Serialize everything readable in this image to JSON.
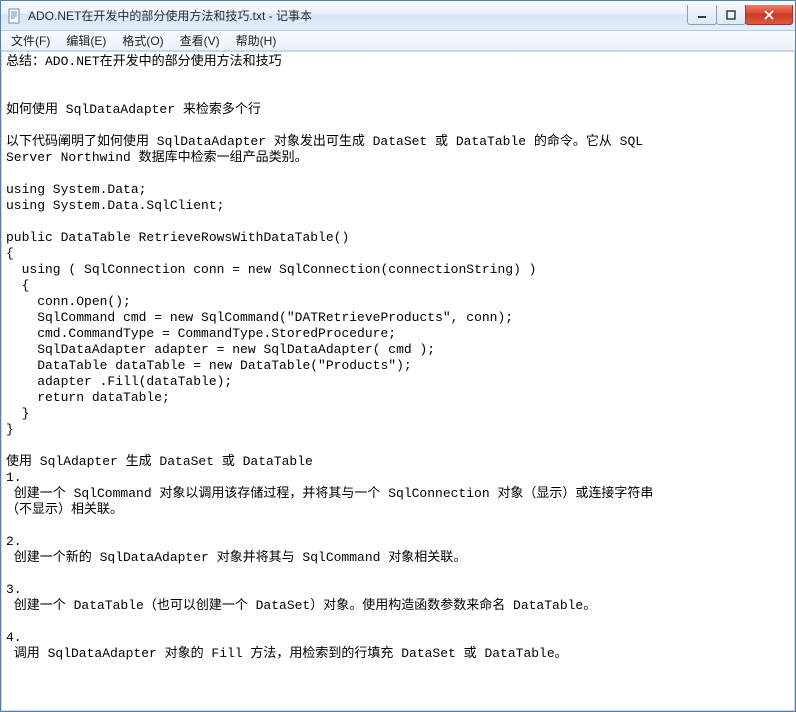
{
  "window": {
    "title": "ADO.NET在开发中的部分使用方法和技巧.txt - 记事本"
  },
  "menu": {
    "file": "文件(F)",
    "edit": "编辑(E)",
    "format": "格式(O)",
    "view": "查看(V)",
    "help": "帮助(H)"
  },
  "document": {
    "text": "总结：ADO.NET在开发中的部分使用方法和技巧\n\n\n如何使用 SqlDataAdapter 来检索多个行\n\n以下代码阐明了如何使用 SqlDataAdapter 对象发出可生成 DataSet 或 DataTable 的命令。它从 SQL\nServer Northwind 数据库中检索一组产品类别。\n\nusing System.Data;\nusing System.Data.SqlClient;\n\npublic DataTable RetrieveRowsWithDataTable()\n{\n  using ( SqlConnection conn = new SqlConnection(connectionString) )\n  {\n    conn.Open();\n    SqlCommand cmd = new SqlCommand(\"DATRetrieveProducts\", conn);\n    cmd.CommandType = CommandType.StoredProcedure;\n    SqlDataAdapter adapter = new SqlDataAdapter( cmd );\n    DataTable dataTable = new DataTable(\"Products\");\n    adapter .Fill(dataTable);\n    return dataTable;\n  }\n}\n\n使用 SqlAdapter 生成 DataSet 或 DataTable\n1.\n 创建一个 SqlCommand 对象以调用该存储过程，并将其与一个 SqlConnection 对象（显示）或连接字符串\n（不显示）相关联。\n\n2.\n 创建一个新的 SqlDataAdapter 对象并将其与 SqlCommand 对象相关联。\n\n3.\n 创建一个 DataTable（也可以创建一个 DataSet）对象。使用构造函数参数来命名 DataTable。\n\n4.\n 调用 SqlDataAdapter 对象的 Fill 方法，用检索到的行填充 DataSet 或 DataTable。\n"
  }
}
